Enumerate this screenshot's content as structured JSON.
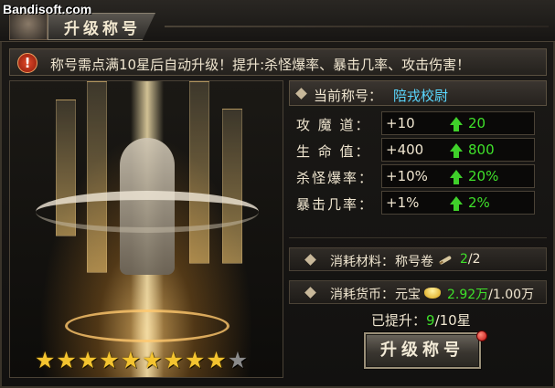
{
  "watermark": "Bandisoft.com",
  "header": {
    "title": "升级称号"
  },
  "notice": {
    "icon": "alert-icon",
    "text": "称号需点满10星后自动升级！提升:杀怪爆率、暴击几率、攻击伤害！"
  },
  "current_title": {
    "label": "当前称号：",
    "value": "陪戎校尉"
  },
  "stats": [
    {
      "label": "攻 魔 道：",
      "base": "+10",
      "next": "20"
    },
    {
      "label": "生 命 值：",
      "base": "+400",
      "next": "800"
    },
    {
      "label": "杀怪爆率：",
      "base": "+10%",
      "next": "20%"
    },
    {
      "label": "暴击几率：",
      "base": "+1%",
      "next": "2%"
    }
  ],
  "material": {
    "label": "消耗材料：",
    "item": "称号卷",
    "have": "2",
    "need": "/2"
  },
  "currency": {
    "label": "消耗货币：",
    "item": "元宝",
    "have": "2.92万",
    "need": "/1.00万"
  },
  "progress": {
    "label": "已提升：",
    "current": "9",
    "max": "/10星"
  },
  "stars": {
    "filled": 9,
    "total": 10
  },
  "upgrade_button": {
    "label": "升级称号"
  },
  "colors": {
    "accent_cyan": "#5ad8ff",
    "up_green": "#3fe02a",
    "star_gold": "#f4c430"
  }
}
